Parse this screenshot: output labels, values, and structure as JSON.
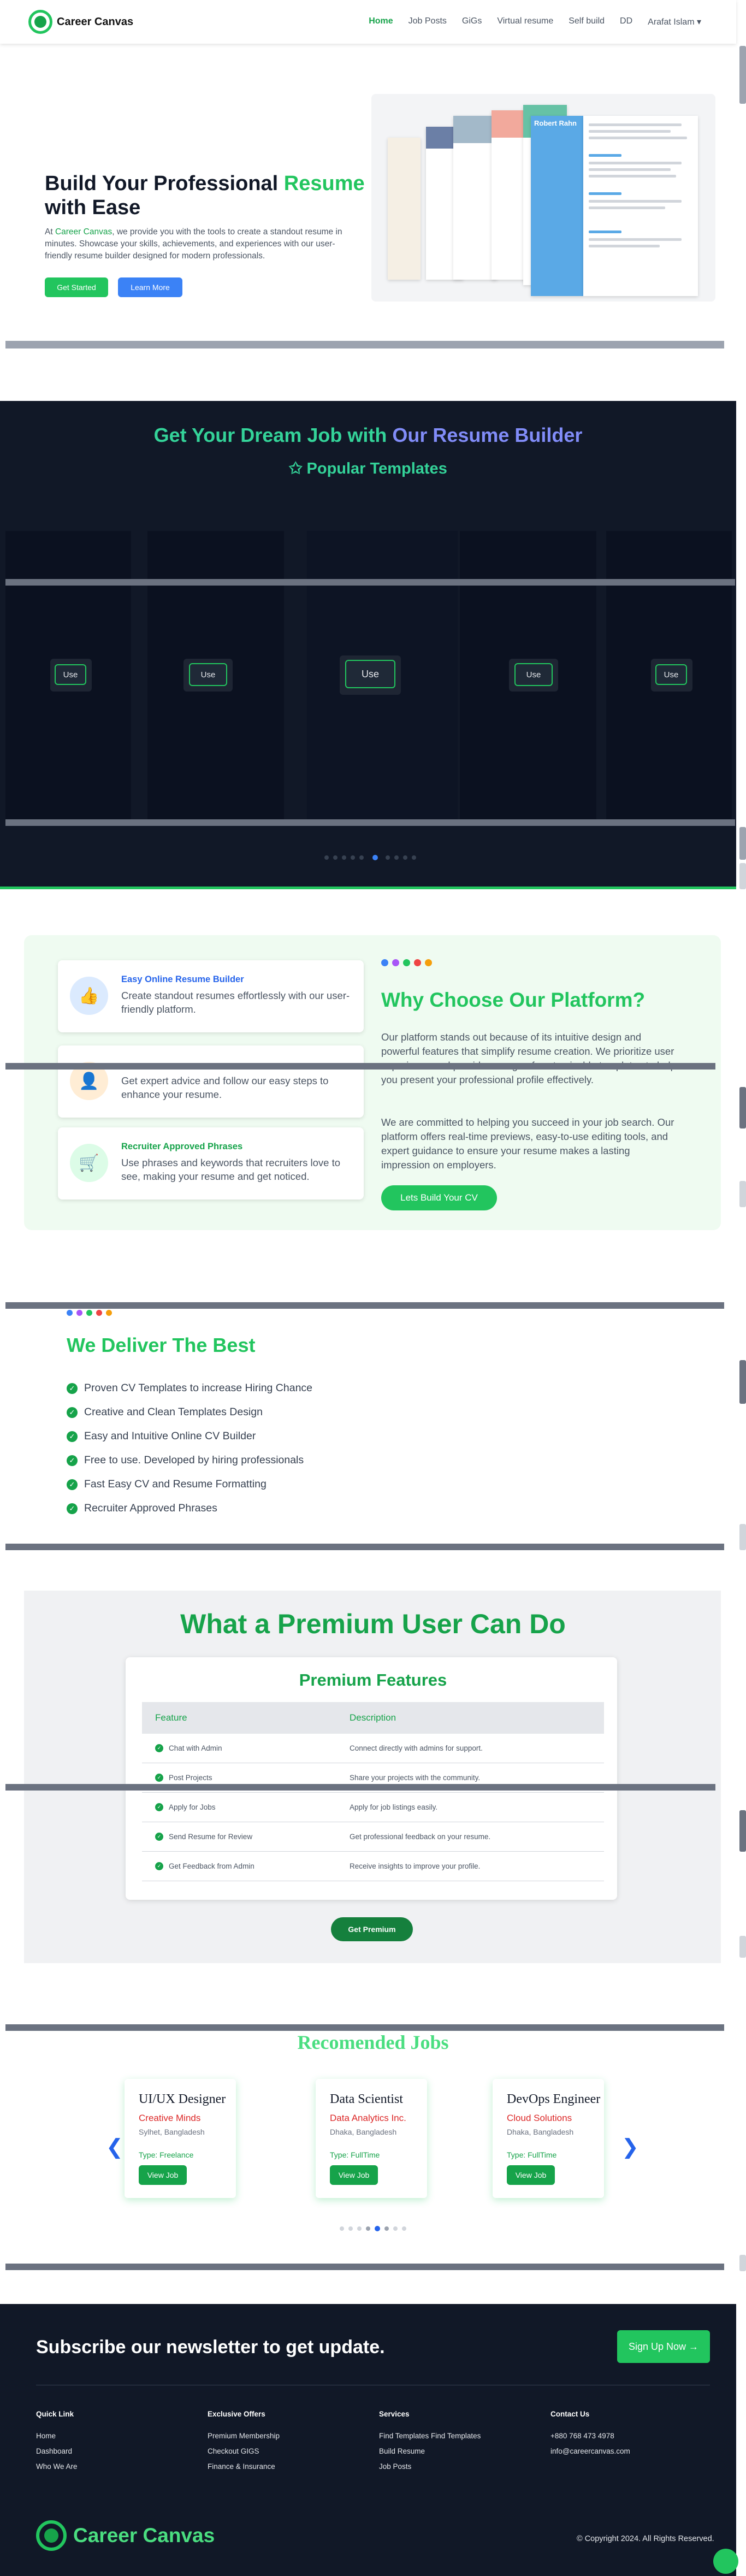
{
  "nav": {
    "brand": "Career Canvas",
    "links": [
      "Home",
      "Job Posts",
      "GiGs",
      "Virtual resume",
      "Self build",
      "DD"
    ],
    "user": "Arafat Islam"
  },
  "hero": {
    "title_pre": "Build Your Professional ",
    "title_accent": "Resume",
    "title_post": " with Ease",
    "text_pre": "At ",
    "text_brand": "Career Canvas",
    "text_post": ", we provide you with the tools to create a standout resume in minutes. Showcase your skills, achievements, and experiences with our user-friendly resume builder designed for modern professionals.",
    "btn_primary": "Get Started",
    "btn_secondary": "Learn More",
    "preview_name": "Robert Rahn"
  },
  "templates": {
    "title_part1": "Get Your Dream Job with ",
    "title_part2": "Our Resume Builder",
    "subtitle": "✩ Popular Templates",
    "use_label": "Use"
  },
  "why": {
    "features": [
      {
        "title": "Easy Online Resume Builder",
        "text": "Create standout resumes effortlessly with our user-friendly platform.",
        "color": "#2563eb"
      },
      {
        "title": "",
        "text": "Get expert advice and follow our easy steps to enhance your resume.",
        "color": "#f97316"
      },
      {
        "title": "Recruiter Approved Phrases",
        "text": "Use phrases and keywords that recruiters love to see, making your resume and get noticed.",
        "color": "#16a34a"
      }
    ],
    "title": "Why Choose Our Platform?",
    "p1": "Our platform stands out because of its intuitive design and powerful features that simplify resume creation. We prioritize user experience and provide a range of customizable templates to help you present your professional profile effectively.",
    "p2": "We are committed to helping you succeed in your job search. Our platform offers real-time previews, easy-to-use editing tools, and expert guidance to ensure your resume makes a lasting impression on employers.",
    "cta": "Lets Build Your CV"
  },
  "deliver": {
    "title": "We Deliver The Best",
    "items": [
      "Proven CV Templates to increase Hiring Chance",
      "Creative and Clean Templates Design",
      "Easy and Intuitive Online CV Builder",
      "Free to use. Developed by hiring professionals",
      "Fast Easy CV and Resume Formatting",
      "Recruiter Approved Phrases"
    ]
  },
  "premium": {
    "title": "What a Premium User Can Do",
    "subtitle": "Premium Features",
    "col_feature": "Feature",
    "col_description": "Description",
    "rows": [
      {
        "feature": "Chat with Admin",
        "description": "Connect directly with admins for support."
      },
      {
        "feature": "Post Projects",
        "description": "Share your projects with the community."
      },
      {
        "feature": "Apply for Jobs",
        "description": "Apply for job listings easily."
      },
      {
        "feature": "Send Resume for Review",
        "description": "Get professional feedback on your resume."
      },
      {
        "feature": "Get Feedback from Admin",
        "description": "Receive insights to improve your profile."
      }
    ],
    "cta": "Get Premium"
  },
  "jobs": {
    "title": "Recomended Jobs",
    "cards": [
      {
        "title": "UI/UX Designer",
        "company": "Creative Minds",
        "location": "Sylhet, Bangladesh",
        "type": "Type: Freelance",
        "button": "View Job"
      },
      {
        "title": "Data Scientist",
        "company": "Data Analytics Inc.",
        "location": "Dhaka, Bangladesh",
        "type": "Type: FullTime",
        "button": "View Job"
      },
      {
        "title": "DevOps Engineer",
        "company": "Cloud Solutions",
        "location": "Dhaka, Bangladesh",
        "type": "Type: FullTime",
        "button": "View Job"
      }
    ],
    "prev": "❮",
    "next": "❯"
  },
  "footer": {
    "newsletter": "Subscribe our newsletter to get update.",
    "signup": "Sign Up Now  →",
    "cols": [
      {
        "heading": "Quick Link",
        "items": [
          "Home",
          "Dashboard",
          "Who We Are"
        ]
      },
      {
        "heading": "Exclusive Offers",
        "items": [
          "Premium Membership",
          "Checkout GIGS",
          "Finance & Insurance"
        ]
      },
      {
        "heading": "Services",
        "items": [
          "Find Templates Find Templates",
          "Build Resume",
          "Job Posts"
        ]
      },
      {
        "heading": "Contact Us",
        "items": [
          "+880 768 473 4978",
          "info@careercanvas.com"
        ]
      }
    ],
    "brand": "Career Canvas",
    "copyright": "© Copyright 2024. All Rights Reserved."
  }
}
